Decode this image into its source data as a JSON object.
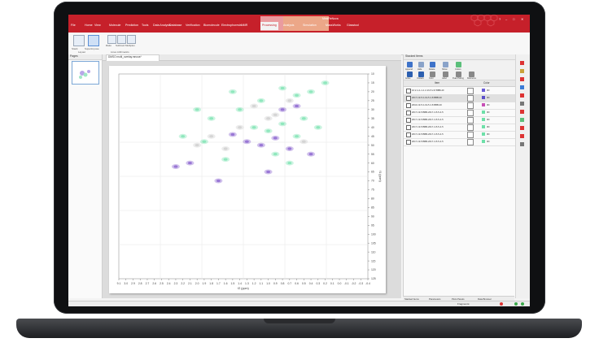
{
  "app": {
    "window_title": "MestReNova",
    "window_controls": [
      "?",
      "–",
      "□",
      "✕"
    ]
  },
  "ribbon": {
    "tabs": [
      "File",
      "Home",
      "View",
      "Molecule",
      "Prediction",
      "Tools",
      "Data Analysis",
      "Database",
      "Verification",
      "Biomolecule",
      "Electrophoresis",
      "NMR",
      "Processing",
      "Analysis",
      "Simulation",
      "MassWorks",
      "Glasstool"
    ],
    "active_tab_index": 12,
    "buttons": [
      "Stack",
      "Superimpose",
      "Ratio",
      "Subtract",
      "Multiplex"
    ],
    "group_labels": [
      "Layout",
      "Lines Arithmetics"
    ]
  },
  "left_pane": {
    "title": "Pages"
  },
  "document": {
    "tab_label": "DMSO multi_overlay.mnova*"
  },
  "right_pane": {
    "title": "Stacked Items",
    "toolbar": [
      "Append",
      "Hide",
      "Delete",
      "Show",
      "Colors",
      "Active",
      "Unstack",
      "Color",
      "Label",
      "Peak Picking",
      "Reference"
    ],
    "columns": [
      "",
      "Item",
      "",
      "Color"
    ],
    "rows": [
      {
        "name": "10:2-1-1-1-1 2-19-5 2-8 BBB-40",
        "color": "#6a5bd6",
        "color_label": "3D",
        "selected": false
      },
      {
        "name": "2017-19-5 2-19-5 2-8 BBB-40",
        "color": "#5b4fc8",
        "color_label": "3D",
        "selected": true
      },
      {
        "name": "2016-19-5 2-19-5 2-8 BBB-40",
        "color": "#c74fb5",
        "color_label": "3D",
        "selected": false
      },
      {
        "name": "2017-19-5 BBB-2017-4-5-5-4-5",
        "color": "#6ee0a9",
        "color_label": "3D",
        "selected": false
      },
      {
        "name": "2017-19-5 BBB-2017-4-5-5-4-5",
        "color": "#6ee0a9",
        "color_label": "3D",
        "selected": false
      },
      {
        "name": "2017-19-5 BBB-2017-4-5-5-4-5",
        "color": "#6ee0a9",
        "color_label": "3D",
        "selected": false
      },
      {
        "name": "2017-19-5 BBB-2017-4-5-5-4-5",
        "color": "#6ee0a9",
        "color_label": "3D",
        "selected": false
      },
      {
        "name": "2017-19-5 BBB-2017-4-5-5-4-5",
        "color": "#6ee0a9",
        "color_label": "3D",
        "selected": false
      }
    ],
    "bottom_tabs": [
      "Stacked Items",
      "Parameters",
      "Plots Panels",
      "Data Browser"
    ]
  },
  "status_bar": {
    "text": "Fragments:"
  },
  "chart_data": {
    "type": "scatter",
    "x_ticks": [
      "9.1",
      "3.0",
      "2.9",
      "2.8",
      "2.7",
      "2.6",
      "2.5",
      "2.4",
      "2.3",
      "2.2",
      "2.1",
      "2.0",
      "1.9",
      "1.8",
      "1.7",
      "1.6",
      "1.5",
      "1.4",
      "1.3",
      "1.2",
      "1.1",
      "1.0",
      "0.9",
      "0.8",
      "0.7",
      "0.6",
      "0.5",
      "0.4",
      "0.3",
      "0.2",
      "0.1",
      "0.0",
      "-0.1",
      "-0.2",
      "-0.3",
      "-0.4"
    ],
    "xlabel": "f2 (ppm)",
    "y_ticks": [
      "10",
      "15",
      "20",
      "25",
      "30",
      "35",
      "40",
      "45",
      "50",
      "55",
      "60",
      "65",
      "70",
      "75",
      "80",
      "85",
      "90",
      "95",
      "100",
      "105",
      "110",
      "115",
      "120",
      "125"
    ],
    "ylabel": "f1 (ppm)",
    "series": [
      {
        "color": "#6ee0a9",
        "points": [
          [
            1.2,
            40
          ],
          [
            1.0,
            42
          ],
          [
            0.8,
            38
          ],
          [
            0.6,
            45
          ],
          [
            1.4,
            30
          ],
          [
            0.9,
            55
          ],
          [
            0.7,
            60
          ],
          [
            1.6,
            58
          ],
          [
            0.5,
            35
          ],
          [
            0.3,
            40
          ],
          [
            1.8,
            35
          ],
          [
            2.0,
            30
          ],
          [
            1.1,
            25
          ],
          [
            0.4,
            20
          ],
          [
            0.2,
            15
          ],
          [
            1.5,
            20
          ],
          [
            0.8,
            18
          ],
          [
            0.6,
            22
          ],
          [
            2.2,
            45
          ],
          [
            1.9,
            48
          ]
        ]
      },
      {
        "color": "#7b4fc9",
        "points": [
          [
            1.3,
            48
          ],
          [
            1.1,
            50
          ],
          [
            0.9,
            46
          ],
          [
            0.7,
            52
          ],
          [
            1.5,
            44
          ],
          [
            0.8,
            30
          ],
          [
            0.6,
            28
          ],
          [
            2.1,
            60
          ],
          [
            1.0,
            65
          ],
          [
            1.7,
            70
          ],
          [
            0.4,
            55
          ],
          [
            2.3,
            62
          ]
        ]
      },
      {
        "color": "#c9c9c9",
        "points": [
          [
            1.0,
            35
          ],
          [
            1.2,
            28
          ],
          [
            0.9,
            33
          ],
          [
            1.4,
            40
          ],
          [
            0.5,
            48
          ],
          [
            1.8,
            45
          ],
          [
            0.7,
            25
          ],
          [
            2.0,
            50
          ],
          [
            1.6,
            52
          ]
        ]
      }
    ],
    "grid": true
  }
}
